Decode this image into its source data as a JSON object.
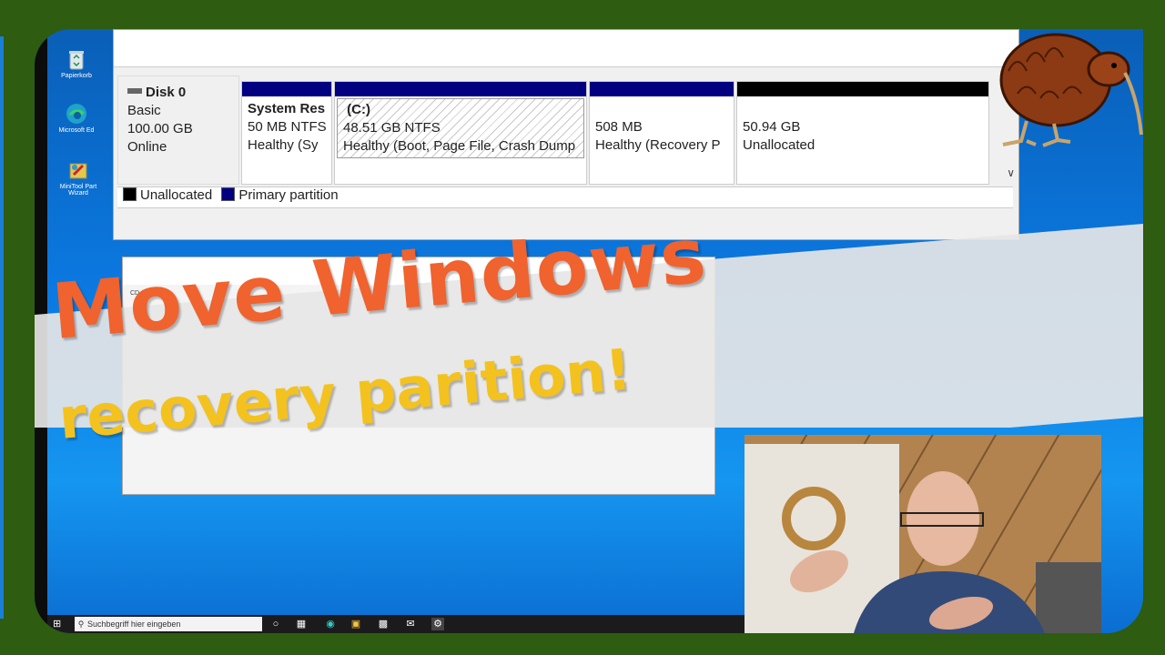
{
  "desktop": {
    "icons": [
      {
        "label": "Papierkorb",
        "icon": "recycle-bin-icon"
      },
      {
        "label": "Microsoft Ed",
        "icon": "edge-icon"
      },
      {
        "label": "MiniTool Part Wizard",
        "icon": "minitool-icon"
      }
    ]
  },
  "disk_management": {
    "disk": {
      "name": "Disk 0",
      "type": "Basic",
      "size": "100.00 GB",
      "status": "Online"
    },
    "partitions": [
      {
        "name": "System Res",
        "size": "50 MB NTFS",
        "status": "Healthy (Sy"
      },
      {
        "name": "(C:)",
        "size": "48.51 GB NTFS",
        "status": "Healthy (Boot, Page File, Crash Dump"
      },
      {
        "name": "",
        "size": "508 MB",
        "status": "Healthy (Recovery P"
      },
      {
        "name": "",
        "size": "50.94 GB",
        "status": "Unallocated"
      }
    ],
    "legend": {
      "unallocated": "Unallocated",
      "primary": "Primary partition"
    },
    "colors": {
      "primary": "#000080",
      "unallocated": "#000000"
    }
  },
  "second_window": {
    "disk_label": "CD 0"
  },
  "banner": {
    "title": "Move Windows",
    "subtitle": "recovery parition!",
    "title_color": "#f0622e",
    "subtitle_color": "#f4c21e"
  },
  "taskbar": {
    "search_placeholder": "Suchbegriff hier eingeben",
    "icons": [
      "windows-start-icon",
      "search-icon",
      "cortana-icon",
      "task-view-icon",
      "edge-icon",
      "file-explorer-icon",
      "store-icon",
      "mail-icon",
      "minitool-icon"
    ]
  }
}
